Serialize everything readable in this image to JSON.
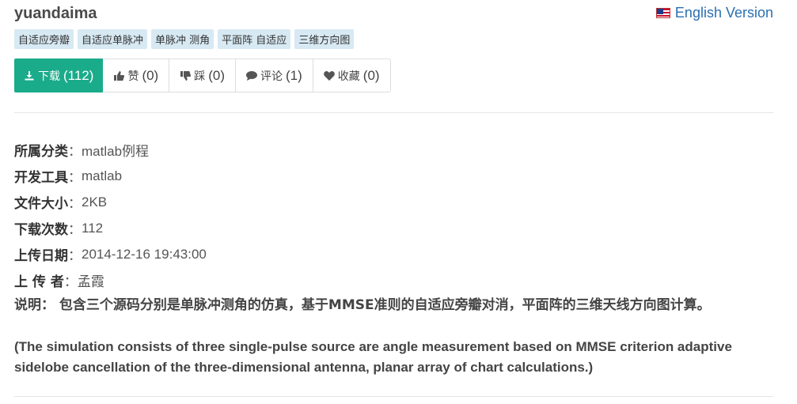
{
  "header": {
    "title": "yuandaima",
    "english_link": "English Version"
  },
  "tags": [
    "自适应旁瓣",
    "自适应单脉冲",
    "单脉冲 测角",
    "平面阵 自适应",
    "三维方向图"
  ],
  "actions": {
    "download": {
      "label": "下载",
      "count": "(112)"
    },
    "like": {
      "label": "赞",
      "count": "(0)"
    },
    "dislike": {
      "label": "踩",
      "count": "(0)"
    },
    "comment": {
      "label": "评论",
      "count": "(1)"
    },
    "favorite": {
      "label": "收藏",
      "count": "(0)"
    }
  },
  "info": {
    "category": {
      "label": "所属分类",
      "value": "matlab例程"
    },
    "tool": {
      "label": "开发工具",
      "value": "matlab"
    },
    "size": {
      "label": "文件大小",
      "value": "2KB"
    },
    "downloads": {
      "label": "下载次数",
      "value": "112"
    },
    "date": {
      "label": "上传日期",
      "value": "2014-12-16 19:43:00"
    },
    "uploader": {
      "label": "上 传 者",
      "value": "孟霞"
    }
  },
  "description": {
    "label": "说明：",
    "text": "包含三个源码分别是单脉冲测角的仿真，基于MMSE准则的自适应旁瓣对消，平面阵的三维天线方向图计算。",
    "english": "(The simulation consists of three single-pulse source are angle measurement based on MMSE criterion adaptive sidelobe cancellation of the three-dimensional antenna, planar array of chart calculations.)"
  },
  "colors": {
    "primary": "#1aab8a",
    "tag_bg": "#d7e9f3",
    "link": "#2a6fb0"
  },
  "icons": {
    "download": "download-icon",
    "like": "thumbs-up-icon",
    "dislike": "thumbs-down-icon",
    "comment": "comment-icon",
    "favorite": "heart-icon",
    "flag": "us-flag-icon"
  }
}
